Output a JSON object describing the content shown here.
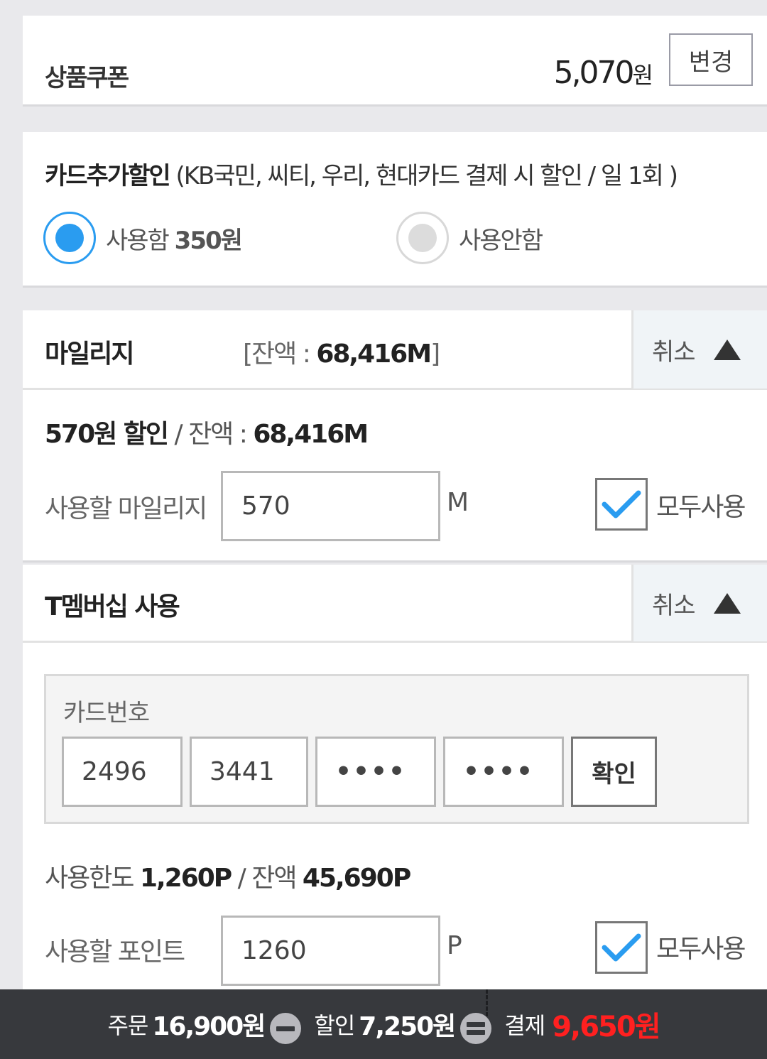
{
  "coupon": {
    "title": "상품쿠폰",
    "amount": "5,070",
    "unit": "원",
    "change_label": "변경"
  },
  "card_discount": {
    "title_bold": "카드추가할인",
    "title_detail": " (KB국민, 씨티, 우리, 현대카드 결제 시 할인 / 일 1회 )",
    "option_use_label": "사용함 ",
    "option_use_amount": "350원",
    "option_nouse_label": "사용안함",
    "selected": "use"
  },
  "mileage": {
    "title": "마일리지",
    "balance_prefix": "[잔액 : ",
    "balance_value": "68,416M",
    "balance_suffix": "]",
    "cancel_label": "취소",
    "summary_discount": "570원 할인",
    "summary_sep": " / 잔액 : ",
    "summary_balance": "68,416M",
    "input_label": "사용할 마일리지",
    "input_value": "570",
    "unit": "M",
    "use_all_label": "모두사용",
    "use_all_checked": true
  },
  "tmembership": {
    "title": "T멤버십 사용",
    "cancel_label": "취소",
    "card_number_label": "카드번호",
    "card_numbers": [
      "2496",
      "3441",
      "••••",
      "••••"
    ],
    "confirm_label": "확인",
    "limit_prefix": "사용한도 ",
    "limit_value": "1,260P",
    "limit_sep": " / 잔액 ",
    "balance_value": "45,690P",
    "input_label": "사용할 포인트",
    "input_value": "1260",
    "unit": "P",
    "use_all_label": "모두사용",
    "use_all_checked": true
  },
  "bottom_bar": {
    "order_label": "주문",
    "order_value": "16,900원",
    "discount_label": "할인",
    "discount_value": "7,250원",
    "pay_label": "결제",
    "pay_value": "9,650원"
  },
  "colors": {
    "accent_blue": "#2a9cf0",
    "pay_red": "#ff2020",
    "bar_bg": "#37393d"
  }
}
